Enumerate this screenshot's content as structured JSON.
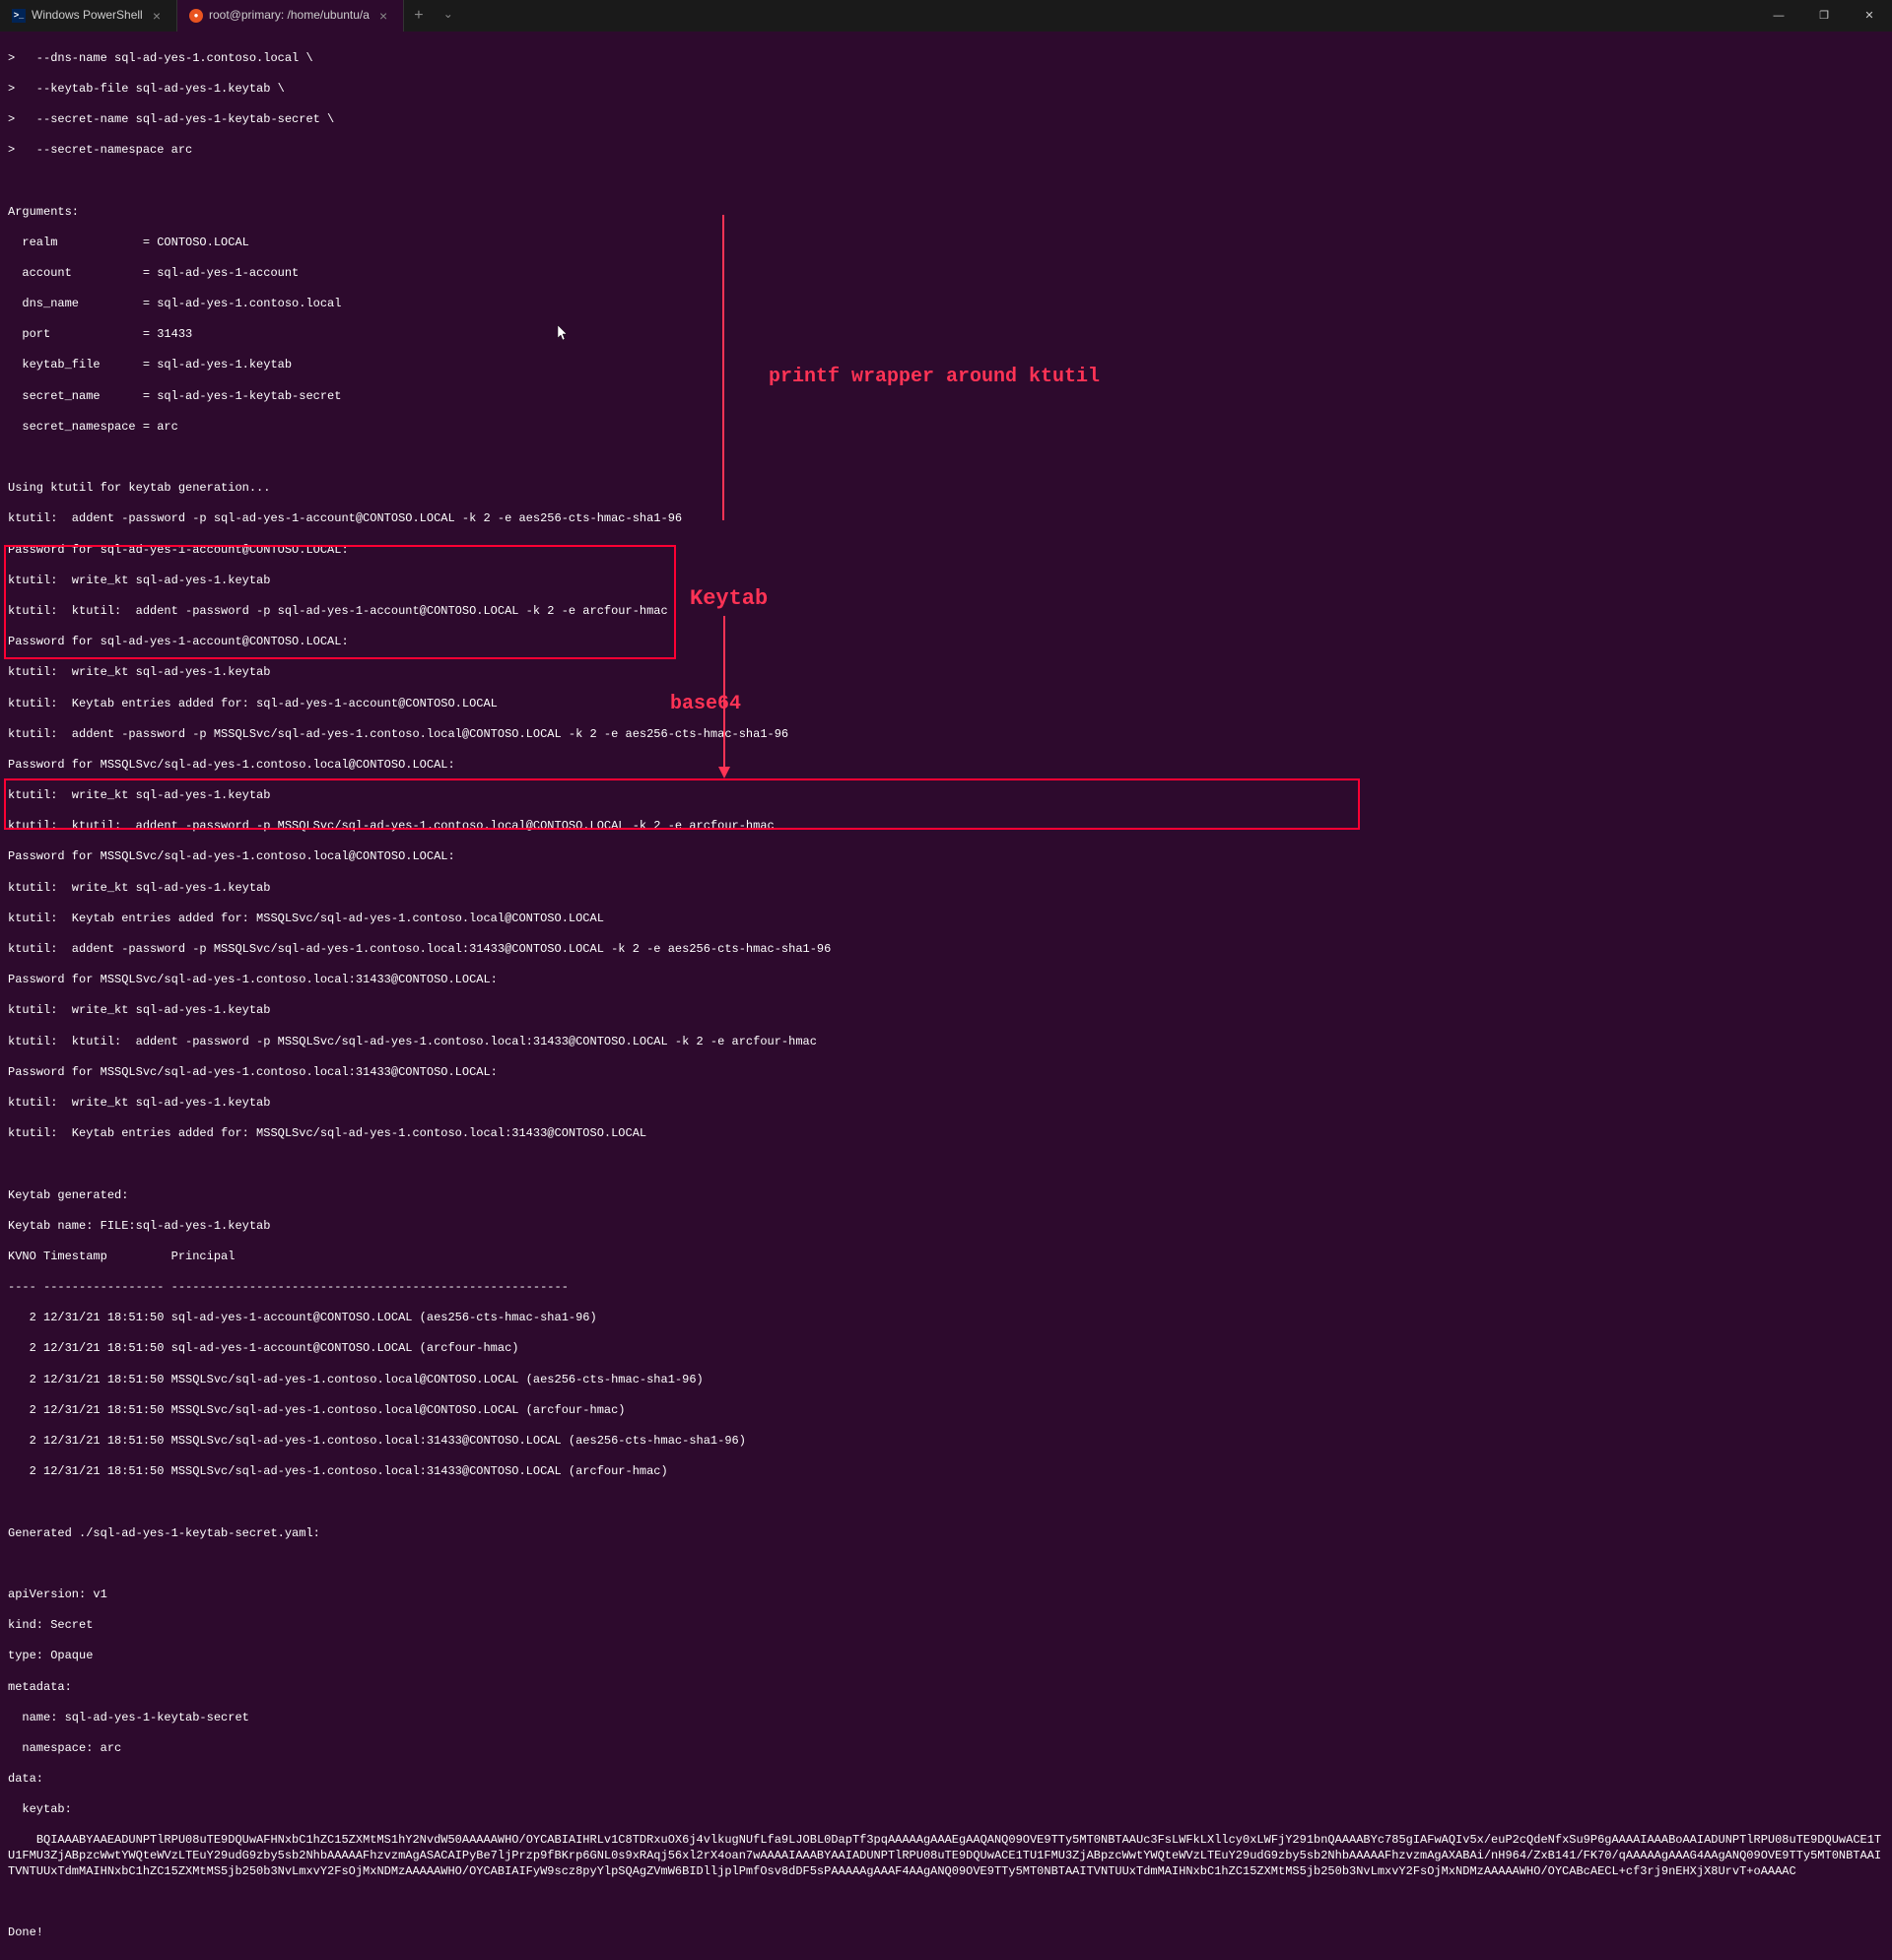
{
  "titlebar": {
    "tabs": [
      {
        "icon": "powershell",
        "title": "Windows PowerShell",
        "active": false
      },
      {
        "icon": "ubuntu",
        "title": "root@primary: /home/ubuntu/a",
        "active": true
      }
    ],
    "newTab": "+",
    "dropdown": "⌄",
    "minimize": "—",
    "maximize": "❐",
    "close": "✕"
  },
  "terminal": {
    "commandArgs": [
      ">   --dns-name sql-ad-yes-1.contoso.local \\",
      ">   --keytab-file sql-ad-yes-1.keytab \\",
      ">   --secret-name sql-ad-yes-1-keytab-secret \\",
      ">   --secret-namespace arc"
    ],
    "argumentsHeader": "Arguments:",
    "arguments": [
      "  realm            = CONTOSO.LOCAL",
      "  account          = sql-ad-yes-1-account",
      "  dns_name         = sql-ad-yes-1.contoso.local",
      "  port             = 31433",
      "  keytab_file      = sql-ad-yes-1.keytab",
      "  secret_name      = sql-ad-yes-1-keytab-secret",
      "  secret_namespace = arc"
    ],
    "ktutilLines": [
      "Using ktutil for keytab generation...",
      "ktutil:  addent -password -p sql-ad-yes-1-account@CONTOSO.LOCAL -k 2 -e aes256-cts-hmac-sha1-96",
      "Password for sql-ad-yes-1-account@CONTOSO.LOCAL:",
      "ktutil:  write_kt sql-ad-yes-1.keytab",
      "ktutil:  ktutil:  addent -password -p sql-ad-yes-1-account@CONTOSO.LOCAL -k 2 -e arcfour-hmac",
      "Password for sql-ad-yes-1-account@CONTOSO.LOCAL:",
      "ktutil:  write_kt sql-ad-yes-1.keytab",
      "ktutil:  Keytab entries added for: sql-ad-yes-1-account@CONTOSO.LOCAL",
      "ktutil:  addent -password -p MSSQLSvc/sql-ad-yes-1.contoso.local@CONTOSO.LOCAL -k 2 -e aes256-cts-hmac-sha1-96",
      "Password for MSSQLSvc/sql-ad-yes-1.contoso.local@CONTOSO.LOCAL:",
      "ktutil:  write_kt sql-ad-yes-1.keytab",
      "ktutil:  ktutil:  addent -password -p MSSQLSvc/sql-ad-yes-1.contoso.local@CONTOSO.LOCAL -k 2 -e arcfour-hmac",
      "Password for MSSQLSvc/sql-ad-yes-1.contoso.local@CONTOSO.LOCAL:",
      "ktutil:  write_kt sql-ad-yes-1.keytab",
      "ktutil:  Keytab entries added for: MSSQLSvc/sql-ad-yes-1.contoso.local@CONTOSO.LOCAL",
      "ktutil:  addent -password -p MSSQLSvc/sql-ad-yes-1.contoso.local:31433@CONTOSO.LOCAL -k 2 -e aes256-cts-hmac-sha1-96",
      "Password for MSSQLSvc/sql-ad-yes-1.contoso.local:31433@CONTOSO.LOCAL:",
      "ktutil:  write_kt sql-ad-yes-1.keytab",
      "ktutil:  ktutil:  addent -password -p MSSQLSvc/sql-ad-yes-1.contoso.local:31433@CONTOSO.LOCAL -k 2 -e arcfour-hmac",
      "Password for MSSQLSvc/sql-ad-yes-1.contoso.local:31433@CONTOSO.LOCAL:",
      "ktutil:  write_kt sql-ad-yes-1.keytab",
      "ktutil:  Keytab entries added for: MSSQLSvc/sql-ad-yes-1.contoso.local:31433@CONTOSO.LOCAL"
    ],
    "keytabGenerated": "Keytab generated:",
    "keytabName": "Keytab name: FILE:sql-ad-yes-1.keytab",
    "keytabHeader": "KVNO Timestamp         Principal",
    "keytabDivider": "---- ----------------- --------------------------------------------------------",
    "keytabEntries": [
      "   2 12/31/21 18:51:50 sql-ad-yes-1-account@CONTOSO.LOCAL (aes256-cts-hmac-sha1-96)",
      "   2 12/31/21 18:51:50 sql-ad-yes-1-account@CONTOSO.LOCAL (arcfour-hmac)",
      "   2 12/31/21 18:51:50 MSSQLSvc/sql-ad-yes-1.contoso.local@CONTOSO.LOCAL (aes256-cts-hmac-sha1-96)",
      "   2 12/31/21 18:51:50 MSSQLSvc/sql-ad-yes-1.contoso.local@CONTOSO.LOCAL (arcfour-hmac)",
      "   2 12/31/21 18:51:50 MSSQLSvc/sql-ad-yes-1.contoso.local:31433@CONTOSO.LOCAL (aes256-cts-hmac-sha1-96)",
      "   2 12/31/21 18:51:50 MSSQLSvc/sql-ad-yes-1.contoso.local:31433@CONTOSO.LOCAL (arcfour-hmac)"
    ],
    "generatedFile": "Generated ./sql-ad-yes-1-keytab-secret.yaml:",
    "yamlLines": [
      "apiVersion: v1",
      "kind: Secret",
      "type: Opaque",
      "metadata:",
      "  name: sql-ad-yes-1-keytab-secret",
      "  namespace: arc",
      "data:",
      "  keytab:"
    ],
    "base64Line": "    BQIAAABYAAEADUNPTlRPU08uTE9DQUwAFHNxbC1hZC15ZXMtMS1hY2NvdW50AAAAAWHO/OYCABIAIHRLv1C8TDRxuOX6j4vlkugNUfLfa9LJOBL0DapTf3pqAAAAAgAAAEgAAQANQ09OVE9TTy5MT0NBTAAUc3FsLWFkLXllcy0xLWFjY291bnQAAAABYc785gIAFwAQIv5x/euP2cQdeNfxSu9P6gAAAAIAAABoAAIADUNPTlRPU08uTE9DQUwACE1TU1FMU3ZjABpzcWwtYWQteWVzLTEuY29udG9zby5sb2NhbAAAAAFhzvzmAgASACAIPyBe7ljPrzp9fBKrp6GNL0s9xRAqj56xl2rX4oan7wAAAAIAAABYAAIADUNPTlRPU08uTE9DQUwACE1TU1FMU3ZjABpzcWwtYWQteWVzLTEuY29udG9zby5sb2NhbAAAAAFhzvzmAgAXABAi/nH964/ZxB141/FK70/qAAAAAgAAAG4AAgANQ09OVE9TTy5MT0NBTAAITVNTUUxTdmMAIHNxbC1hZC15ZXMtMS5jb250b3NvLmxvY2FsOjMxNDMzAAAAAWHO/OYCABIAIFyW9scz8pyYlpSQAgZVmW6BIDlljplPmfOsv8dDF5sPAAAAAgAAAF4AAgANQ09OVE9TTy5MT0NBTAAITVNTUUxTdmMAIHNxbC1hZC15ZXMtMS5jb250b3NvLmxvY2FsOjMxNDMzAAAAAWHO/OYCABcAECL+cf3rj9nEHXjX8UrvT+oAAAAC",
    "done": "Done!"
  },
  "annotations": {
    "printfWrapper": "printf wrapper around ktutil",
    "keytab": "Keytab",
    "base64": "base64"
  }
}
